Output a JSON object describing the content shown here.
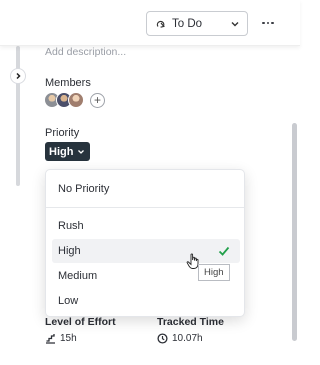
{
  "header": {
    "status_label": "To Do",
    "status_icon": "status-loop-icon",
    "more_icon": "more-horizontal-icon"
  },
  "description": {
    "placeholder": "Add description..."
  },
  "members": {
    "label": "Members",
    "avatars": [
      "avatar-1",
      "avatar-2",
      "avatar-3"
    ],
    "add_label": "+"
  },
  "priority": {
    "label": "Priority",
    "value": "High",
    "options": [
      "No Priority",
      "Rush",
      "High",
      "Medium",
      "Low"
    ],
    "selected": "High"
  },
  "tooltip": {
    "text": "High"
  },
  "fields": {
    "effort": {
      "label": "Level of Effort",
      "value": "15h",
      "icon": "effort-steps-icon"
    },
    "tracked": {
      "label": "Tracked Time",
      "value": "10.07h",
      "icon": "clock-icon"
    }
  },
  "colors": {
    "chip_bg": "#27333d",
    "check": "#22a04b",
    "selected_bg": "#f1f2f4"
  }
}
